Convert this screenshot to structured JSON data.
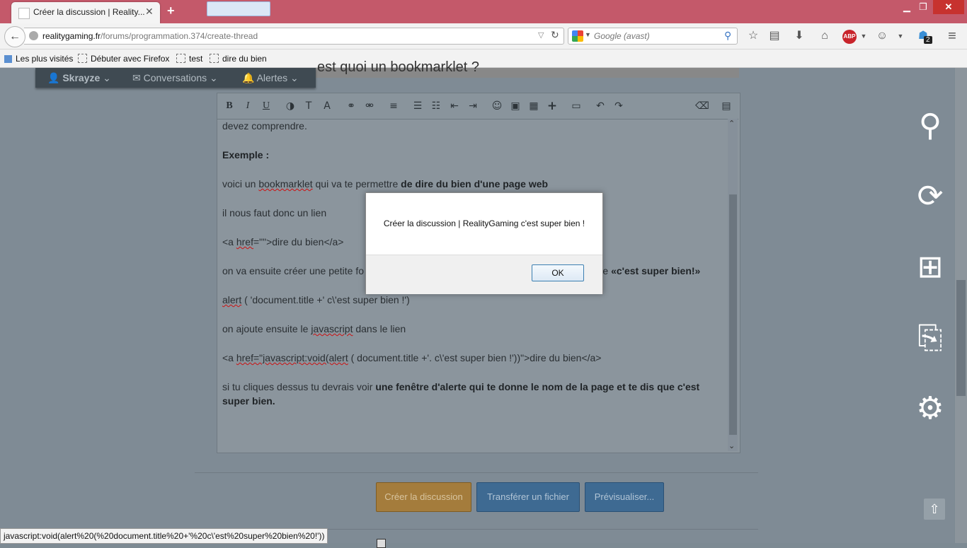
{
  "browser": {
    "tab_title": "Créer la discussion | Reality...",
    "tab_close": "✕",
    "new_tab": "+",
    "window": {
      "minimize": "▁",
      "maximize": "❐",
      "close": "✕"
    },
    "url_host": "realitygaming.fr",
    "url_path": "/forums/programmation.374/create-thread",
    "search_placeholder": "Google (avast)",
    "addon_badge": "2",
    "abp_label": "ABP",
    "bookmarks": [
      "Les plus visités",
      "Débuter avec Firefox",
      "test",
      "dire du bien"
    ]
  },
  "page": {
    "heading_partial": "est quoi un bookmarklet ?",
    "usernav": {
      "user": "Skrayze",
      "conversations": "Conversations",
      "alerts": "Alertes"
    },
    "editor": {
      "paragraphs": [
        {
          "text": "devez comprendre."
        },
        {
          "bold": "Exemple :"
        },
        {
          "pre": "voici un ",
          "sq": "bookmarklet",
          "post": " qui va te permettre ",
          "bold": "de dire du bien d'une page web"
        },
        {
          "text": "il nous faut donc un lien"
        },
        {
          "pre": "<a ",
          "sq": "href",
          "post": "=\"\">dire du bien</a>"
        },
        {
          "pre": "on va ensuite créer une petite fo",
          "post2": "le texte ",
          "bold": "«c'est super bien!»"
        },
        {
          "sq": "alert",
          "post": " ( 'document.title +' c\\'est super bien !')"
        },
        {
          "pre": "on ajoute ensuite le ",
          "sq": "javascript",
          "post": " dans le lien"
        },
        {
          "pre": "<a ",
          "sq": "href=\"javascript:void(alert",
          "post": " ( document.title +'. c\\'est super bien !'))\">dire du bien</a>"
        },
        {
          "pre": "si tu cliques dessus tu devrais voir ",
          "bold": "une fenêtre d'alerte qui te donne le nom de la page et te dis que c'est super bien."
        }
      ]
    },
    "buttons": {
      "create": "Créer la discussion",
      "upload": "Transférer un fichier",
      "preview": "Prévisualiser..."
    }
  },
  "dialog": {
    "message": "Créer la discussion | RealityGaming c'est super bien !",
    "ok": "OK"
  },
  "status_bar": "javascript:void(alert%20(%20document.title%20+'%20c\\'est%20super%20bien%20!'))",
  "colors": {
    "titlebar": "#c4596a",
    "overlay_page": "#7f8b95",
    "create_button": "#a47c3c",
    "blue_button": "#3e6a92"
  }
}
